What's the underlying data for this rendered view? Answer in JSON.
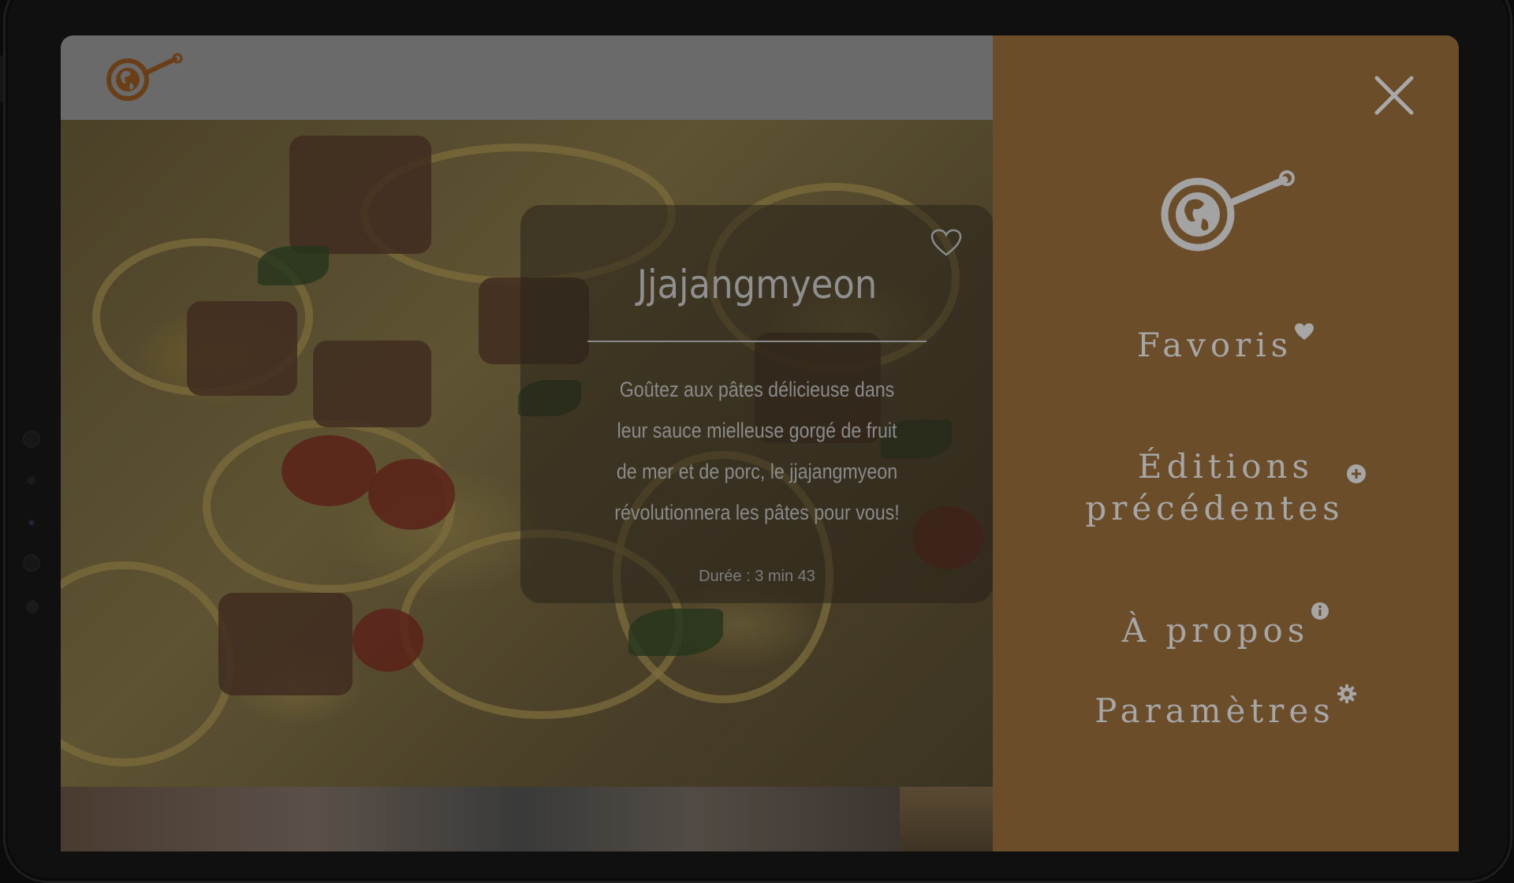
{
  "recipe": {
    "title": "Jjajangmyeon",
    "description": "Goûtez aux pâtes délicieuse dans leur sauce mielleuse gorgé de fruit de mer et de porc, le jjajangmyeon révolutionnera les pâtes pour vous!",
    "duration": "Durée : 3 min 43"
  },
  "menu": {
    "items": [
      {
        "label": "Favoris",
        "icon": "heart-icon"
      },
      {
        "label_line1": "Éditions",
        "label_line2": "précédentes",
        "icon": "plus-circle-icon"
      },
      {
        "label": "À propos",
        "icon": "info-icon"
      },
      {
        "label": "Paramètres",
        "icon": "gear-icon"
      }
    ]
  },
  "colors": {
    "drawer": "#6b4d2a",
    "logo": "#8a5a2e",
    "menu_text": "#a6a6a6"
  }
}
